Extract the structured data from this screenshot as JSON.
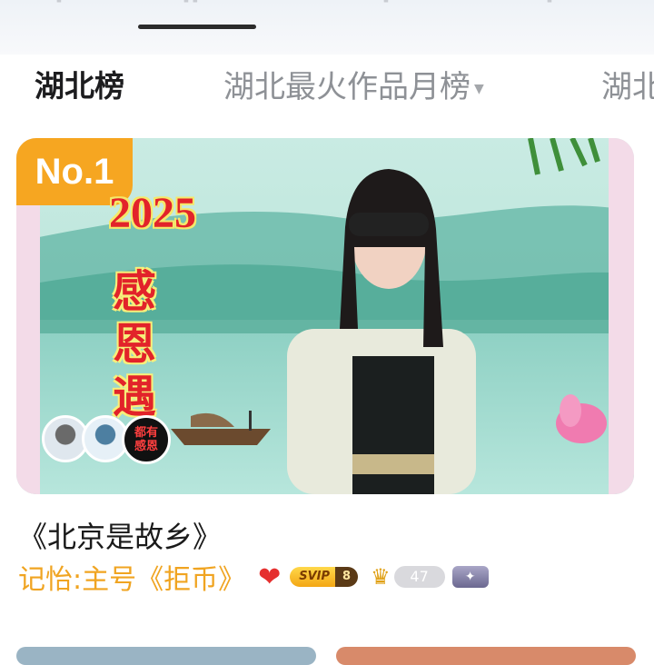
{
  "top_nav": {
    "tabs_partial": [
      "",
      "",
      "",
      ""
    ]
  },
  "sub_tabs": {
    "active": "湖北榜",
    "dropdown": "湖北最火作品月榜",
    "cut_off": "湖北"
  },
  "feed": {
    "first_item": {
      "rank": "No.1",
      "thumbnail_year": "2025",
      "thumbnail_title": "感恩遇",
      "thumbnail_avatar_text": "都有 感恩",
      "song_title": "《北京是故乡》",
      "author": "记怡:主号《拒币》",
      "svip_label": "SVIP",
      "svip_level": "8",
      "fan_level": "47",
      "colors": {
        "rank_badge": "#f6a621",
        "author_text": "#f0a421",
        "heart": "#e5302f"
      },
      "icons": [
        "heart-icon",
        "svip-badge",
        "crown-icon",
        "shield-badge-icon"
      ]
    }
  }
}
